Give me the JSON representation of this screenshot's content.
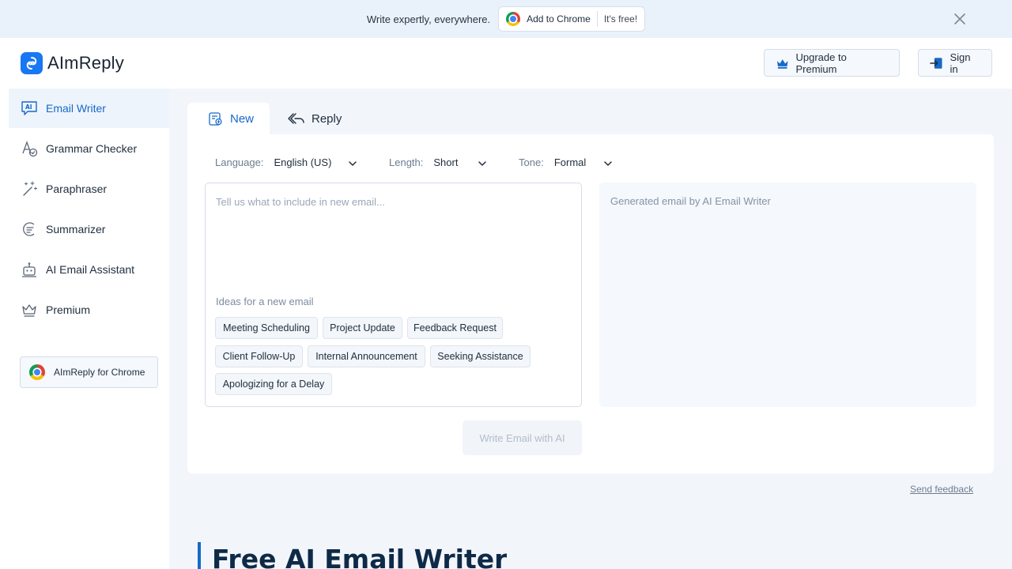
{
  "banner": {
    "text": "Write expertly, everywhere.",
    "cta_label": "Add to Chrome",
    "cta_sub": "It's free!"
  },
  "header": {
    "brand": "AImReply",
    "premium_label": "Upgrade to Premium",
    "signin_label": "Sign in"
  },
  "sidebar": {
    "items": [
      {
        "label": "Email Writer",
        "icon": "ai-chat-icon",
        "active": true
      },
      {
        "label": "Grammar Checker",
        "icon": "grammar-icon"
      },
      {
        "label": "Paraphraser",
        "icon": "wand-icon"
      },
      {
        "label": "Summarizer",
        "icon": "summarize-icon"
      },
      {
        "label": "AI Email Assistant",
        "icon": "robot-icon"
      },
      {
        "label": "Premium",
        "icon": "crown-icon"
      }
    ],
    "chrome_card_label": "AImReply for Chrome"
  },
  "tabs": [
    {
      "label": "New",
      "active": true
    },
    {
      "label": "Reply"
    }
  ],
  "options": {
    "language": {
      "label": "Language:",
      "value": "English (US)"
    },
    "length": {
      "label": "Length:",
      "value": "Short"
    },
    "tone": {
      "label": "Tone:",
      "value": "Formal"
    }
  },
  "input": {
    "placeholder": "Tell us what to include in new email...",
    "ideas_label": "Ideas for a new email",
    "ideas": [
      "Meeting Scheduling",
      "Project Update",
      "Feedback Request",
      "Client Follow-Up",
      "Internal Announcement",
      "Seeking Assistance",
      "Apologizing for a Delay"
    ]
  },
  "output": {
    "placeholder": "Generated email by AI Email Writer"
  },
  "write_button_label": "Write Email with AI",
  "feedback_label": "Send feedback",
  "hero_title": "Free AI Email Writer",
  "colors": {
    "accent": "#1669c8",
    "brand": "#1877f2",
    "background": "#f2f6fb"
  }
}
